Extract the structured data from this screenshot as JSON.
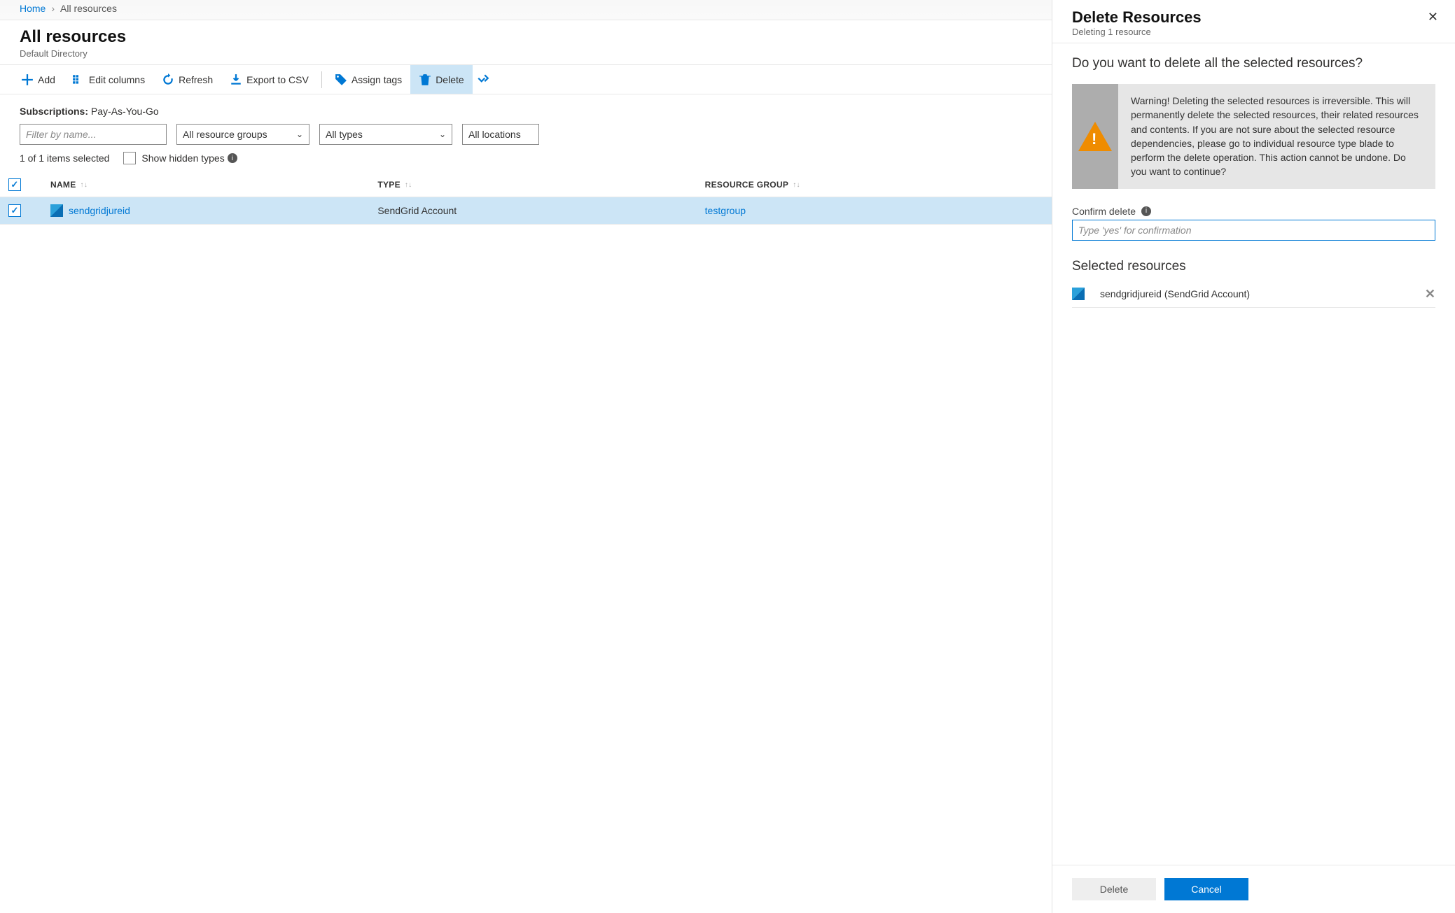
{
  "breadcrumb": {
    "home": "Home",
    "current": "All resources"
  },
  "page": {
    "title": "All resources",
    "subtitle": "Default Directory"
  },
  "toolbar": {
    "add": "Add",
    "edit_columns": "Edit columns",
    "refresh": "Refresh",
    "export_csv": "Export to CSV",
    "assign_tags": "Assign tags",
    "delete": "Delete"
  },
  "filters": {
    "subscriptions_label": "Subscriptions:",
    "subscriptions_value": "Pay-As-You-Go",
    "name_placeholder": "Filter by name...",
    "resource_groups": "All resource groups",
    "types": "All types",
    "locations": "All locations"
  },
  "list_status": {
    "selected_text": "1 of 1 items selected",
    "show_hidden": "Show hidden types"
  },
  "table": {
    "headers": {
      "name": "NAME",
      "type": "TYPE",
      "rg": "RESOURCE GROUP"
    },
    "rows": [
      {
        "name": "sendgridjureid",
        "type": "SendGrid Account",
        "rg": "testgroup",
        "checked": true
      }
    ]
  },
  "side": {
    "title": "Delete Resources",
    "subtitle": "Deleting 1 resource",
    "question": "Do you want to delete all the selected resources?",
    "warning": "Warning! Deleting the selected resources is irreversible. This will permanently delete the selected resources, their related resources and contents. If you are not sure about the selected resource dependencies, please go to individual resource type blade to perform the delete operation. This action cannot be undone. Do you want to continue?",
    "confirm_label": "Confirm delete",
    "confirm_placeholder": "Type 'yes' for confirmation",
    "selected_title": "Selected resources",
    "selected_item": "sendgridjureid  (SendGrid Account)",
    "delete_btn": "Delete",
    "cancel_btn": "Cancel"
  }
}
